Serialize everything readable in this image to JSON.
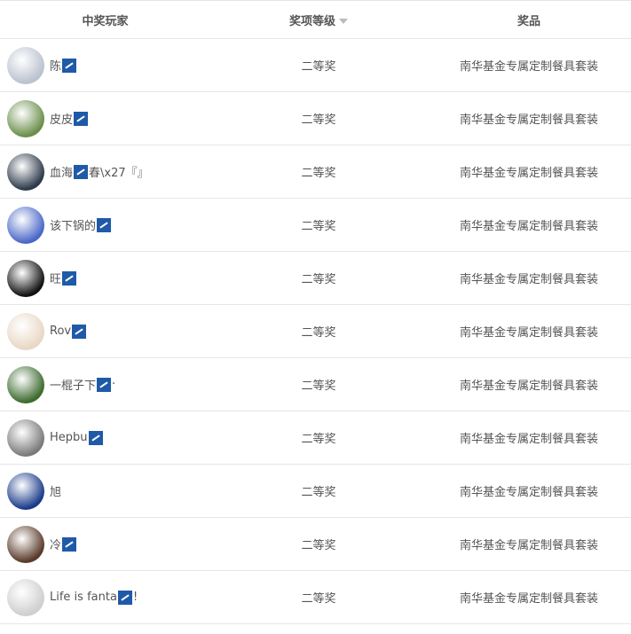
{
  "header": {
    "player": "中奖玩家",
    "level": "奖项等级",
    "prize": "奖品"
  },
  "rows": [
    {
      "name": "陈",
      "suffix": "",
      "level": "二等奖",
      "prize": "南华基金专属定制餐具套装",
      "avatar_color": "#b9c2cf"
    },
    {
      "name": "皮皮",
      "suffix": "",
      "level": "二等奖",
      "prize": "南华基金专属定制餐具套装",
      "avatar_color": "#6b8f4a"
    },
    {
      "name": "血海",
      "suffix": "春\\x27『』",
      "level": "二等奖",
      "prize": "南华基金专属定制餐具套装",
      "avatar_color": "#2d3a4a"
    },
    {
      "name": "该下锅的",
      "suffix": "",
      "level": "二等奖",
      "prize": "南华基金专属定制餐具套装",
      "avatar_color": "#4a67c7"
    },
    {
      "name": "旺",
      "suffix": "",
      "level": "二等奖",
      "prize": "南华基金专属定制餐具套装",
      "avatar_color": "#111111"
    },
    {
      "name": "Rov",
      "suffix": "",
      "level": "二等奖",
      "prize": "南华基金专属定制餐具套装",
      "avatar_color": "#e8d8c4"
    },
    {
      "name": "一棍子下",
      "suffix": "·",
      "level": "二等奖",
      "prize": "南华基金专属定制餐具套装",
      "avatar_color": "#3d6b2f"
    },
    {
      "name": "Hepbu",
      "suffix": "",
      "level": "二等奖",
      "prize": "南华基金专属定制餐具套装",
      "avatar_color": "#7a7a7a"
    },
    {
      "name": "旭",
      "suffix": "",
      "level": "二等奖",
      "prize": "南华基金专属定制餐具套装",
      "avatar_color": "#1b3c8a"
    },
    {
      "name": "冷",
      "suffix": "",
      "level": "二等奖",
      "prize": "南华基金专属定制餐具套装",
      "avatar_color": "#5a3a2a"
    },
    {
      "name": "Life is fanta",
      "suffix": "!",
      "level": "二等奖",
      "prize": "南华基金专属定制餐具套装",
      "avatar_color": "#cfcfcf"
    }
  ]
}
